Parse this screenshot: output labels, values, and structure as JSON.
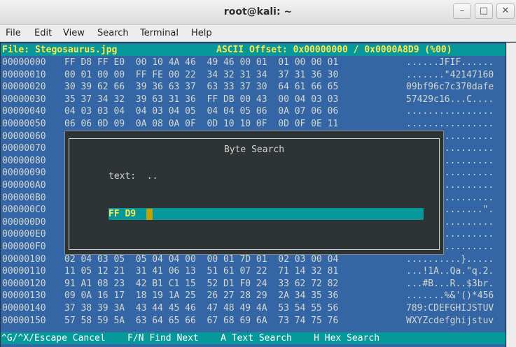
{
  "window": {
    "title": "root@kali: ~",
    "buttons": {
      "minimize": "–",
      "maximize": "□",
      "close": "✕"
    }
  },
  "menu": [
    "File",
    "Edit",
    "View",
    "Search",
    "Terminal",
    "Help"
  ],
  "header": {
    "file": "File: Stegosaurus.jpg",
    "offset": "ASCII Offset: 0x00000000 / 0x0000A8D9 (%00)"
  },
  "rows": [
    {
      "addr": "00000000",
      "hex": "FF D8 FF E0  00 10 4A 46  49 46 00 01  01 00 00 01",
      "ascii": "......JFIF......"
    },
    {
      "addr": "00000010",
      "hex": "00 01 00 00  FF FE 00 22  34 32 31 34  37 31 36 30",
      "ascii": ".......\"42147160"
    },
    {
      "addr": "00000020",
      "hex": "30 39 62 66  39 36 63 37  63 33 37 30  64 61 66 65",
      "ascii": "09bf96c7c370dafe"
    },
    {
      "addr": "00000030",
      "hex": "35 37 34 32  39 63 31 36  FF DB 00 43  00 04 03 03",
      "ascii": "57429c16...C...."
    },
    {
      "addr": "00000040",
      "hex": "04 03 03 04  04 03 04 05  04 04 05 06  0A 07 06 06",
      "ascii": "................"
    },
    {
      "addr": "00000050",
      "hex": "06 06 0D 09  0A 08 0A 0F  0D 10 10 0F  0D 0F 0E 11",
      "ascii": "................"
    },
    {
      "addr": "00000060",
      "hex": "",
      "ascii": "................"
    },
    {
      "addr": "00000070",
      "hex": "",
      "ascii": "................"
    },
    {
      "addr": "00000080",
      "hex": "",
      "ascii": "................"
    },
    {
      "addr": "00000090",
      "hex": "",
      "ascii": "................"
    },
    {
      "addr": "000000A0",
      "hex": "",
      "ascii": "................"
    },
    {
      "addr": "000000B0",
      "hex": "",
      "ascii": "................"
    },
    {
      "addr": "000000C0",
      "hex": "",
      "ascii": "..............\"."
    },
    {
      "addr": "000000D0",
      "hex": "",
      "ascii": "................"
    },
    {
      "addr": "000000E0",
      "hex": "",
      "ascii": "................"
    },
    {
      "addr": "000000F0",
      "hex": "",
      "ascii": "................"
    },
    {
      "addr": "00000100",
      "hex": "02 04 03 05  05 04 04 00  00 01 7D 01  02 03 00 04",
      "ascii": "..........}....."
    },
    {
      "addr": "00000110",
      "hex": "11 05 12 21  31 41 06 13  51 61 07 22  71 14 32 81",
      "ascii": "...!1A..Qa.\"q.2."
    },
    {
      "addr": "00000120",
      "hex": "91 A1 08 23  42 B1 C1 15  52 D1 F0 24  33 62 72 82",
      "ascii": "...#B...R..$3br."
    },
    {
      "addr": "00000130",
      "hex": "09 0A 16 17  18 19 1A 25  26 27 28 29  2A 34 35 36",
      "ascii": ".......%&'()*456"
    },
    {
      "addr": "00000140",
      "hex": "37 38 39 3A  43 44 45 46  47 48 49 4A  53 54 55 56",
      "ascii": "789:CDEFGHIJSTUV"
    },
    {
      "addr": "00000150",
      "hex": "57 58 59 5A  63 64 65 66  67 68 69 6A  73 74 75 76",
      "ascii": "WXYZcdefghijstuv"
    }
  ],
  "dialog": {
    "title": "Byte Search",
    "text_label": "text:  ..",
    "hex_value": "FF D9"
  },
  "footer": "^G/^X/Escape Cancel    F/N Find Next    A Text Search    H Hex Search",
  "colors": {
    "background": "#3465a4",
    "bar": "#06989a",
    "highlight": "#fce94f",
    "cursor": "#c4a000"
  }
}
